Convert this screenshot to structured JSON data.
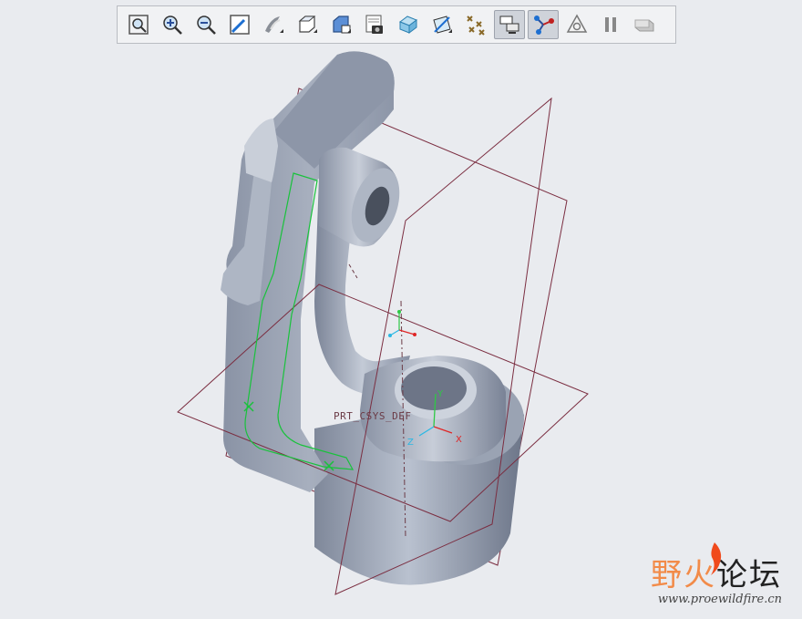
{
  "toolbar": {
    "buttons": [
      {
        "name": "refit-icon"
      },
      {
        "name": "zoom-in-icon"
      },
      {
        "name": "zoom-out-icon"
      },
      {
        "name": "repaint-icon"
      },
      {
        "name": "view-manager-icon"
      },
      {
        "name": "display-style-icon"
      },
      {
        "name": "saved-views-icon"
      },
      {
        "name": "view-snapshot-icon"
      },
      {
        "name": "section-icon"
      },
      {
        "name": "datum-display-icon"
      },
      {
        "name": "datum-points-icon"
      },
      {
        "name": "annotation-display-icon",
        "active": true
      },
      {
        "name": "spin-center-icon",
        "active": true
      },
      {
        "name": "csys-display-icon"
      },
      {
        "name": "pause-icon"
      },
      {
        "name": "tools-icon"
      }
    ]
  },
  "model": {
    "csys_label": "PRT_CSYS_DEF",
    "axis_x": "X",
    "axis_y": "Y",
    "axis_z": "Z"
  },
  "colors": {
    "datum_plane": "#7b2e41",
    "sketch": "#19c23c",
    "body_light": "#b4bccb",
    "body_dark": "#6e7889",
    "axis_x": "#e02626",
    "axis_y": "#2ec945",
    "axis_z": "#2ab8e4"
  },
  "watermark": {
    "title_first": "野火",
    "title_rest": "论坛",
    "url": "www.proewildfire.cn"
  }
}
